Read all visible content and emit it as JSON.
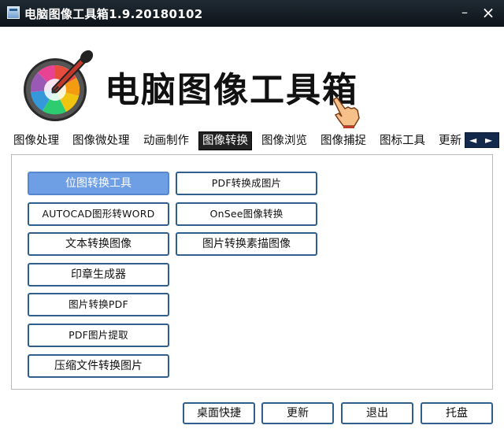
{
  "window": {
    "title": "电脑图像工具箱1.9.20180102",
    "minimize_glyph": "–",
    "close_glyph": "×"
  },
  "header": {
    "app_name": "电脑图像工具箱",
    "logo_icon": "color-picker-eyedropper-icon",
    "pointer_icon": "pointing-hand-icon"
  },
  "tabs": [
    {
      "label": "图像处理",
      "active": false
    },
    {
      "label": "图像微处理",
      "active": false
    },
    {
      "label": "动画制作",
      "active": false
    },
    {
      "label": "图像转换",
      "active": true
    },
    {
      "label": "图像浏览",
      "active": false
    },
    {
      "label": "图像捕捉",
      "active": false
    },
    {
      "label": "图标工具",
      "active": false
    },
    {
      "label": "更新",
      "active": false
    }
  ],
  "tab_scroll": {
    "left": "◄",
    "right": "►"
  },
  "tools": {
    "col1": [
      "位图转换工具",
      "AUTOCAD图形转WORD",
      "文本转换图像",
      "印章生成器",
      "图片转换PDF",
      "PDF图片提取",
      "压缩文件转换图片"
    ],
    "col2": [
      "PDF转换成图片",
      "OnSee图像转换",
      "图片转换素描图像"
    ],
    "selected": "位图转换工具"
  },
  "bottom": {
    "desktop_shortcut": "桌面快捷",
    "update": "更新",
    "exit": "退出",
    "tray": "托盘"
  },
  "colors": {
    "titlebar": "#111a22",
    "selected_button": "#6e9ee3",
    "button_border": "#2f5f8a",
    "active_tab": "#222222"
  }
}
